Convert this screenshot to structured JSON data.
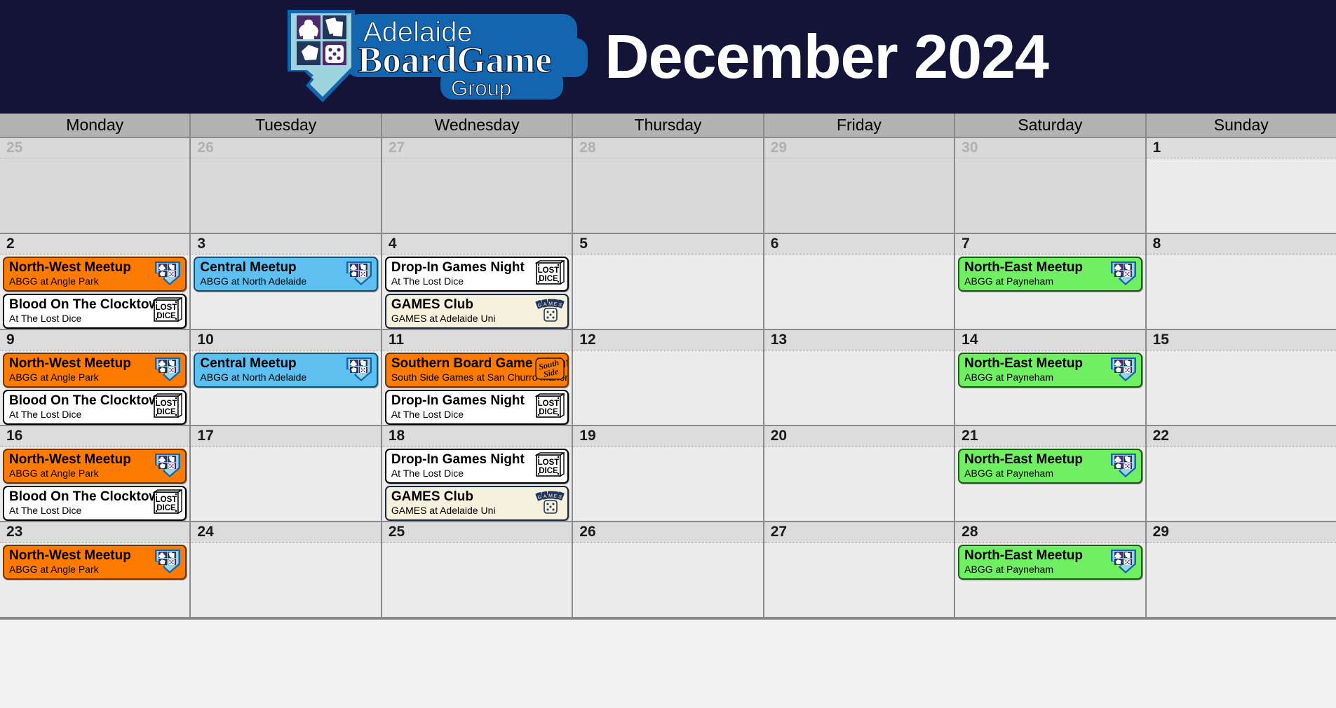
{
  "header": {
    "title": "December 2024",
    "logo": {
      "line1": "Adelaide",
      "line2a": "Board",
      "line2b": "Game",
      "line3": "Group",
      "alt": "adelaide-board-game-group-logo"
    },
    "background_color": "#141438",
    "logo_blue": "#1465b0"
  },
  "calendar": {
    "weekday_headers": [
      "Monday",
      "Tuesday",
      "Wednesday",
      "Thursday",
      "Friday",
      "Saturday",
      "Sunday"
    ],
    "event_colors": {
      "north_west": "#ff7b00",
      "central": "#5dc0f0",
      "north_east": "#71ef62",
      "lost_dice": "#ffffff",
      "games_club": "#f6f1dd",
      "south_side": "#ff7b00"
    },
    "weeks": [
      {
        "days": [
          {
            "num": "25",
            "other_month": true,
            "events": []
          },
          {
            "num": "26",
            "other_month": true,
            "events": []
          },
          {
            "num": "27",
            "other_month": true,
            "events": []
          },
          {
            "num": "28",
            "other_month": true,
            "events": []
          },
          {
            "num": "29",
            "other_month": true,
            "events": []
          },
          {
            "num": "30",
            "other_month": true,
            "events": []
          },
          {
            "num": "1",
            "other_month": false,
            "events": []
          }
        ]
      },
      {
        "days": [
          {
            "num": "2",
            "other_month": false,
            "events": [
              {
                "title": "North-West Meetup",
                "sub": "ABGG at Angle Park",
                "style": "ev-orange",
                "icon": "abgg-logo-icon"
              },
              {
                "title": "Blood On The Clocktower",
                "sub": "At The Lost Dice",
                "style": "ev-white",
                "icon": "lost-dice-logo-icon"
              }
            ]
          },
          {
            "num": "3",
            "other_month": false,
            "events": [
              {
                "title": "Central Meetup",
                "sub": "ABGG at North Adelaide",
                "style": "ev-blue",
                "icon": "abgg-logo-icon"
              }
            ]
          },
          {
            "num": "4",
            "other_month": false,
            "events": [
              {
                "title": "Drop-In Games Night",
                "sub": "At The Lost Dice",
                "style": "ev-white",
                "icon": "lost-dice-logo-icon"
              },
              {
                "title": "GAMES Club",
                "sub": "GAMES at Adelaide Uni",
                "style": "ev-cream",
                "icon": "games-club-logo-icon"
              }
            ]
          },
          {
            "num": "5",
            "other_month": false,
            "events": []
          },
          {
            "num": "6",
            "other_month": false,
            "events": []
          },
          {
            "num": "7",
            "other_month": false,
            "events": [
              {
                "title": "North-East Meetup",
                "sub": "ABGG at Payneham",
                "style": "ev-green",
                "icon": "abgg-logo-icon"
              }
            ]
          },
          {
            "num": "8",
            "other_month": false,
            "events": []
          }
        ]
      },
      {
        "days": [
          {
            "num": "9",
            "other_month": false,
            "events": [
              {
                "title": "North-West Meetup",
                "sub": "ABGG at Angle Park",
                "style": "ev-orange",
                "icon": "abgg-logo-icon"
              },
              {
                "title": "Blood On The Clocktower",
                "sub": "At The Lost Dice",
                "style": "ev-white",
                "icon": "lost-dice-logo-icon"
              }
            ]
          },
          {
            "num": "10",
            "other_month": false,
            "events": [
              {
                "title": "Central Meetup",
                "sub": "ABGG at North Adelaide",
                "style": "ev-blue",
                "icon": "abgg-logo-icon"
              }
            ]
          },
          {
            "num": "11",
            "other_month": false,
            "events": [
              {
                "title": "Southern Board Game Night",
                "sub": "South Side Games at San Churro Marion",
                "style": "ev-orange",
                "icon": "south-side-logo-icon"
              },
              {
                "title": "Drop-In Games Night",
                "sub": "At The Lost Dice",
                "style": "ev-white",
                "icon": "lost-dice-logo-icon"
              },
              {
                "title": "GAMES Club",
                "sub": "GAMES at Adelaide Uni",
                "style": "ev-cream",
                "icon": "games-club-logo-icon"
              }
            ]
          },
          {
            "num": "12",
            "other_month": false,
            "events": []
          },
          {
            "num": "13",
            "other_month": false,
            "events": []
          },
          {
            "num": "14",
            "other_month": false,
            "events": [
              {
                "title": "North-East Meetup",
                "sub": "ABGG at Payneham",
                "style": "ev-green",
                "icon": "abgg-logo-icon"
              }
            ]
          },
          {
            "num": "15",
            "other_month": false,
            "events": []
          }
        ]
      },
      {
        "days": [
          {
            "num": "16",
            "other_month": false,
            "events": [
              {
                "title": "North-West Meetup",
                "sub": "ABGG at Angle Park",
                "style": "ev-orange",
                "icon": "abgg-logo-icon"
              },
              {
                "title": "Blood On The Clocktower",
                "sub": "At The Lost Dice",
                "style": "ev-white",
                "icon": "lost-dice-logo-icon"
              }
            ]
          },
          {
            "num": "17",
            "other_month": false,
            "events": []
          },
          {
            "num": "18",
            "other_month": false,
            "events": [
              {
                "title": "Drop-In Games Night",
                "sub": "At The Lost Dice",
                "style": "ev-white",
                "icon": "lost-dice-logo-icon"
              },
              {
                "title": "GAMES Club",
                "sub": "GAMES at Adelaide Uni",
                "style": "ev-cream",
                "icon": "games-club-logo-icon"
              }
            ]
          },
          {
            "num": "19",
            "other_month": false,
            "events": []
          },
          {
            "num": "20",
            "other_month": false,
            "events": []
          },
          {
            "num": "21",
            "other_month": false,
            "events": [
              {
                "title": "North-East Meetup",
                "sub": "ABGG at Payneham",
                "style": "ev-green",
                "icon": "abgg-logo-icon"
              }
            ]
          },
          {
            "num": "22",
            "other_month": false,
            "events": []
          }
        ]
      },
      {
        "days": [
          {
            "num": "23",
            "other_month": false,
            "events": [
              {
                "title": "North-West Meetup",
                "sub": "ABGG at Angle Park",
                "style": "ev-orange",
                "icon": "abgg-logo-icon"
              }
            ]
          },
          {
            "num": "24",
            "other_month": false,
            "events": []
          },
          {
            "num": "25",
            "other_month": false,
            "events": []
          },
          {
            "num": "26",
            "other_month": false,
            "events": []
          },
          {
            "num": "27",
            "other_month": false,
            "events": []
          },
          {
            "num": "28",
            "other_month": false,
            "events": [
              {
                "title": "North-East Meetup",
                "sub": "ABGG at Payneham",
                "style": "ev-green",
                "icon": "abgg-logo-icon"
              }
            ]
          },
          {
            "num": "29",
            "other_month": false,
            "events": []
          }
        ]
      }
    ]
  }
}
